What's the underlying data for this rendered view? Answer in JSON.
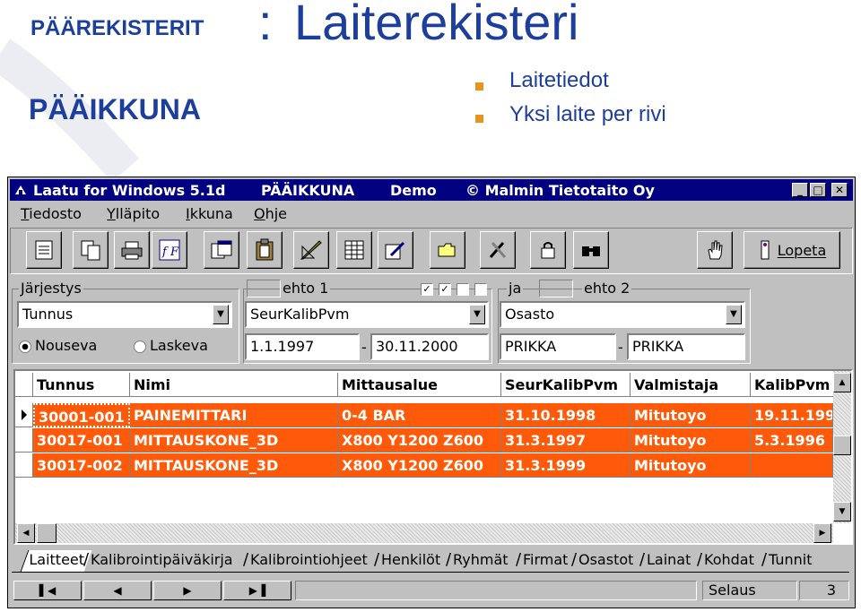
{
  "slide": {
    "prefix": "PÄÄREKISTERIT",
    "colon": ":",
    "title": "Laiterekisteri",
    "subtitle": "PÄÄIKKUNA",
    "bullets": [
      "Laitetiedot",
      "Yksi laite per rivi"
    ],
    "bullet_color": "#e8941a",
    "text_color": "#1d3f9c"
  },
  "window": {
    "title": "Laatu for Windows 5.1d",
    "title_mode": "PÄÄIKKUNA",
    "title_demo": "Demo",
    "title_copyright": "© Malmin Tietotaito Oy",
    "title_bar_color": "#000080",
    "menu": [
      {
        "hot": "T",
        "rest": "iedosto"
      },
      {
        "hot": "Y",
        "rest": "lläpito"
      },
      {
        "hot": "I",
        "rest": "kkuna"
      },
      {
        "hot": "O",
        "rest": "hje"
      }
    ],
    "toolbar_icons": [
      "form-icon",
      "copy-icon",
      "print-icon",
      "function-icon",
      "windows-icon",
      "clipboard-icon",
      "ruler-icon",
      "grid-icon",
      "edit-icon",
      "folder-icon",
      "tools-icon",
      "lock-icon",
      "binoculars-icon",
      "hand-icon",
      "exit-icon"
    ],
    "exit_label": "Lopeta",
    "sort_group_label": "Järjestys",
    "sort_field": "Tunnus",
    "sort_options": [
      "Nouseva",
      "Laskeva"
    ],
    "sort_selected": "Nouseva",
    "cond1_label": "ehto 1",
    "cond1_field": "SeurKalibPvm",
    "cond1_from": "1.1.1997",
    "cond1_to": "30.11.2000",
    "range_dash": "-",
    "checkboxes": [
      true,
      true,
      false,
      false
    ],
    "join_label": "ja",
    "cond2_label": "ehto 2",
    "cond2_field": "Osasto",
    "cond2_from": "PRIKKA",
    "cond2_to": "PRIKKA",
    "columns": [
      "Tunnus",
      "Nimi",
      "Mittausalue",
      "SeurKalibPvm",
      "Valmistaja",
      "KalibPvm"
    ],
    "rows": [
      [
        "30001-001",
        "PAINEMITTARI",
        "0-4 BAR",
        "31.10.1998",
        "Mitutoyo",
        "19.11.199"
      ],
      [
        "30017-001",
        "MITTAUSKONE_3D",
        "X800 Y1200 Z600",
        "31.3.1997",
        "Mitutoyo",
        "5.3.1996"
      ],
      [
        "30017-002",
        "MITTAUSKONE_3D",
        "X800 Y1200 Z600",
        "31.3.1999",
        "Mitutoyo",
        ""
      ]
    ],
    "row_color": "#ff5a0a",
    "tabs": [
      "Laitteet",
      "Kalibrointipäiväkirja",
      "Kalibrointiohjeet",
      "Henkilöt",
      "Ryhmät",
      "Firmat",
      "Osastot",
      "Lainat",
      "Kohdat",
      "Tunnit"
    ],
    "active_tab": "Laitteet",
    "nav_buttons": [
      "first-record-icon",
      "previous-record-icon",
      "next-record-icon",
      "last-record-icon"
    ],
    "status_label": "Selaus",
    "status_count": "3"
  }
}
